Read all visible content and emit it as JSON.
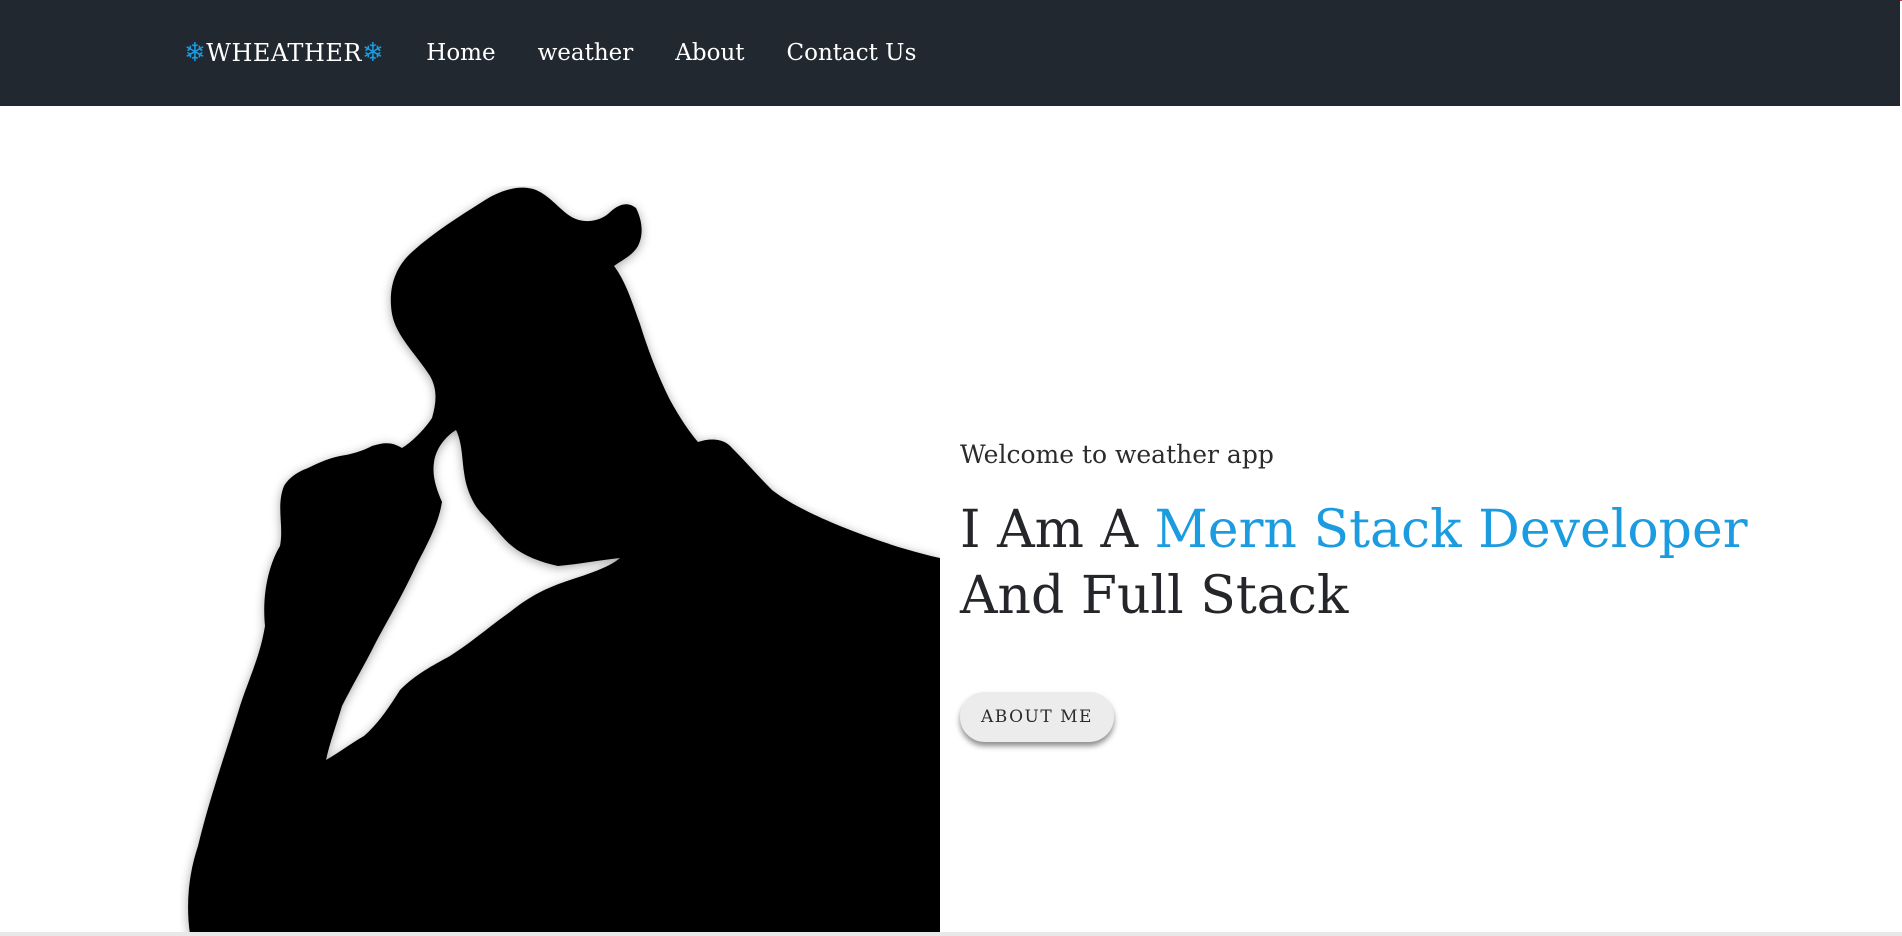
{
  "navbar": {
    "brand": {
      "icon_left": "❄",
      "label": "WHEATHER",
      "icon_right": "❄"
    },
    "links": [
      {
        "label": "Home"
      },
      {
        "label": "weather"
      },
      {
        "label": "About"
      },
      {
        "label": "Contact Us"
      }
    ]
  },
  "hero": {
    "welcome": "Welcome to weather app",
    "headline_prefix": "I Am A",
    "headline_accent": "Mern Stack Developer",
    "headline_suffix": "And Full Stack",
    "button_label": "ABOUT ME",
    "image": "silhouette-man-with-hat"
  },
  "colors": {
    "navbar_bg": "#212830",
    "accent": "#1b9be0",
    "text": "#24262a"
  }
}
